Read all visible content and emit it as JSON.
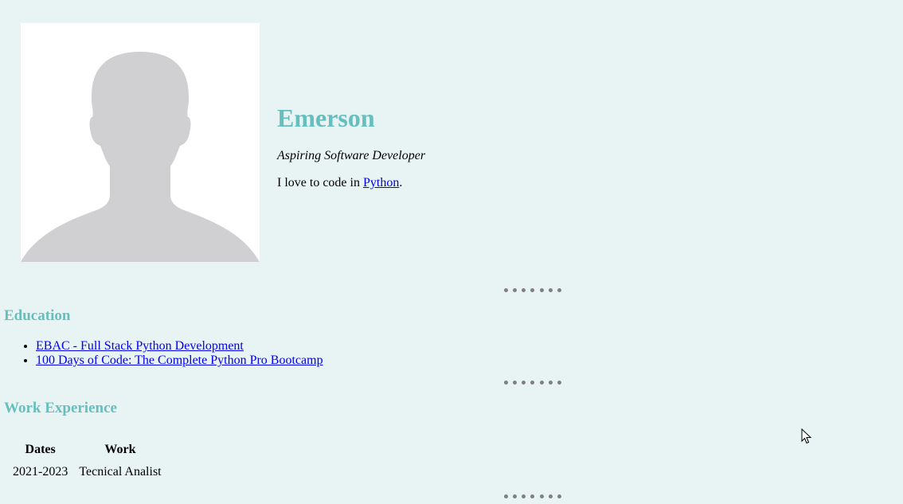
{
  "profile": {
    "name": "Emerson",
    "tagline": "Aspiring Software Developer",
    "bio_prefix": "I love to code in ",
    "bio_link": "Python",
    "bio_suffix": "."
  },
  "education": {
    "heading": "Education",
    "items": [
      "EBAC - Full Stack Python Development",
      "100 Days of Code: The Complete Python Pro Bootcamp"
    ]
  },
  "work": {
    "heading": "Work Experience",
    "columns": [
      "Dates",
      "Work"
    ],
    "rows": [
      [
        "2021-2023",
        "Tecnical Analist"
      ]
    ]
  },
  "colors": {
    "background": "#e8f4f4",
    "heading": "#66bfbf",
    "link": "#0000ee",
    "divider_dots": "#808080",
    "avatar_silhouette": "#d0d0d2"
  },
  "icons": {
    "avatar": "person-silhouette",
    "cursor": "mouse-pointer"
  }
}
